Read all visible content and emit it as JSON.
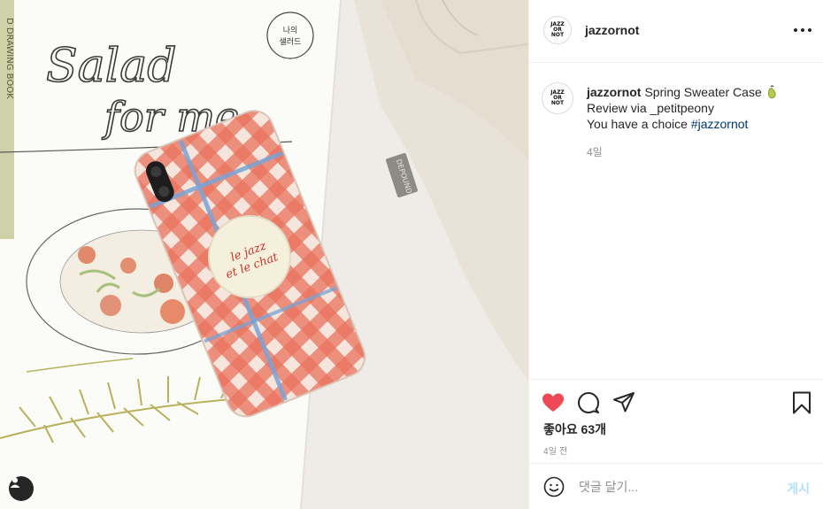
{
  "post": {
    "username": "jazzornot",
    "avatar_text": [
      "JAZZ",
      "OR",
      "NOT"
    ],
    "caption": {
      "username": "jazzornot",
      "line1": "Spring Sweater Case",
      "line2": "Review via _petitpeony",
      "line3": "You have a choice",
      "hashtag": "#jazzornot",
      "time": "4일"
    },
    "likes_text": "좋아요 63개",
    "date_text": "4일 전",
    "liked": true,
    "like_color": "#ed4956"
  },
  "photo": {
    "sketchbook_words": [
      "Salad",
      "for me"
    ],
    "stamp_text": [
      "나의",
      "샐러드"
    ],
    "spine_text": "D DRAWING BOOK",
    "bag_label": "DEPOUND",
    "grip_text": [
      "le jazz",
      "et le chat"
    ]
  },
  "comment": {
    "placeholder": "댓글 달기...",
    "post_label": "게시"
  },
  "icons": {
    "like": "heart-icon",
    "comment": "comment-icon",
    "share": "send-icon",
    "save": "bookmark-icon",
    "emoji": "smiley-icon",
    "more": "more-icon",
    "user_tag": "user-icon"
  }
}
